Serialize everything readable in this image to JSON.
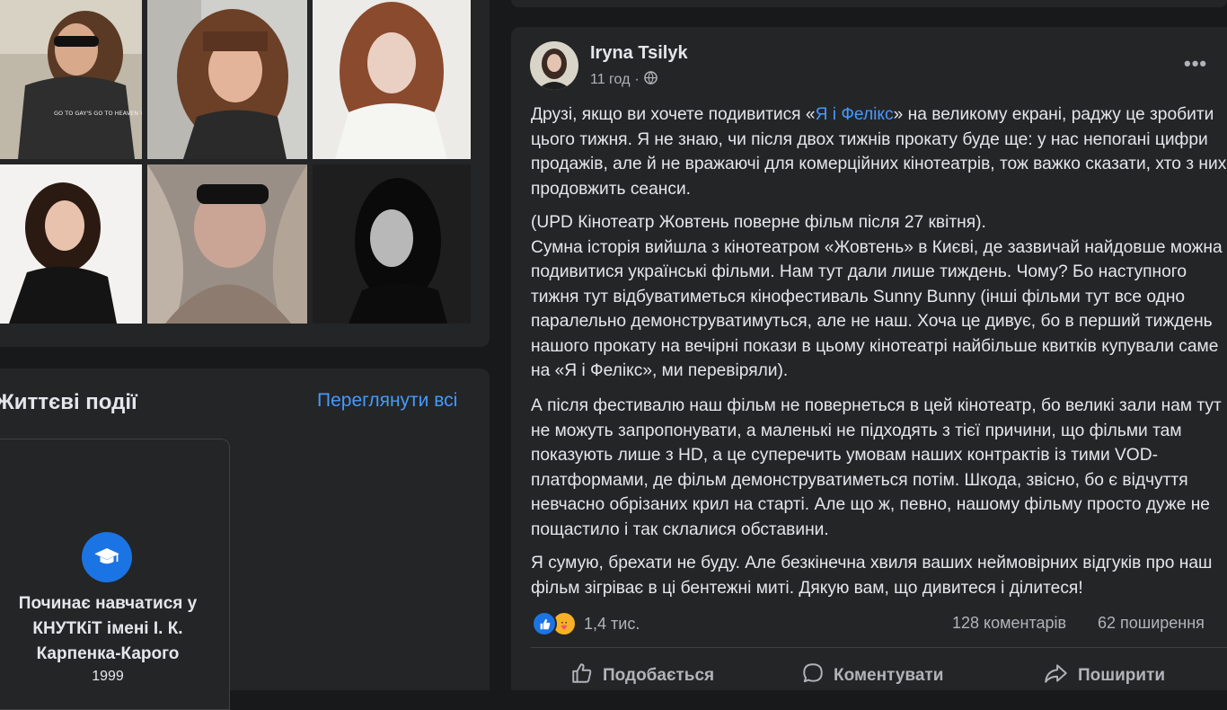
{
  "photos": [
    {
      "name": "photo-1",
      "caption": "GO TO GAY'S GO TO HEAVEN VALHALLA"
    },
    {
      "name": "photo-2"
    },
    {
      "name": "photo-3"
    },
    {
      "name": "photo-4"
    },
    {
      "name": "photo-5"
    },
    {
      "name": "photo-6"
    }
  ],
  "life_events": {
    "title": "Життєві події",
    "see_all": "Переглянути всі",
    "event": {
      "icon": "graduation-cap-icon",
      "lines": [
        "Починає навчатися у",
        "КНУТКіТ імені І. К.",
        "Карпенка-Карого"
      ],
      "year": "1999"
    }
  },
  "post": {
    "author": "Iryna Tsilyk",
    "time": "11 год",
    "privacy_icon": "globe-icon",
    "more": "•••",
    "p1_before": "Друзі, якщо ви хочете подивитися «",
    "p1_link": "Я і Фелікс",
    "p1_after": "» на великому екрані, раджу це зробити цього тижня. Я не знаю, чи після двох тижнів прокату буде ще: у нас непогані цифри продажів, але й не вражаючі для комерційних кінотеатрів, тож важко сказати, хто з них продовжить сеанси.",
    "p2": "(UPD Кінотеатр Жовтень поверне фільм після 27 квітня).\nСумна історія вийшла з кінотеатром «Жовтень» в Києві, де зазвичай найдовше можна подивитися українські фільми. Нам тут дали лише тиждень. Чому? Бо наступного тижня тут відбуватиметься кінофестиваль Sunny Bunny (інші фільми тут все одно паралельно демонструватимуться, але не наш. Хоча це дивує, бо в перший тиждень нашого прокату на вечірні покази в цьому кінотеатрі найбільше квитків купували саме на «Я і Фелікс», ми перевіряли).",
    "p3": "А після фестивалю наш фільм не повернеться в цей кінотеатр, бо великі зали нам тут не можуть запропонувати, а маленькі не підходять з тієї причини, що фільми там показують лише з HD, а це суперечить умовам наших контрактів із тими VOD- платформами, де фільм демонструватиметься потім. Шкода, звісно, бо є відчуття невчасно обрізаних крил на старті. Але що ж, певно, нашому фільму просто дуже не пощастило і так склалися обставини.",
    "p4": "Я сумую, брехати не буду. Але безкінечна хвиля ваших неймовірних відгуків про наш фільм зігріває в ці бентежні миті. Дякую вам, що дивитеся і ділитеся!",
    "reactions": {
      "icons": [
        "like-icon",
        "care-icon"
      ],
      "count": "1,4 тис."
    },
    "comments": "128 коментарів",
    "shares": "62 поширення",
    "actions": {
      "like": "Подобається",
      "comment": "Коментувати",
      "share": "Поширити"
    }
  },
  "colors": {
    "background": "#18191a",
    "card": "#242526",
    "text": "#e4e6eb",
    "secondary": "#b0b3b8",
    "link": "#4599ff",
    "accent": "#1b74e4"
  }
}
